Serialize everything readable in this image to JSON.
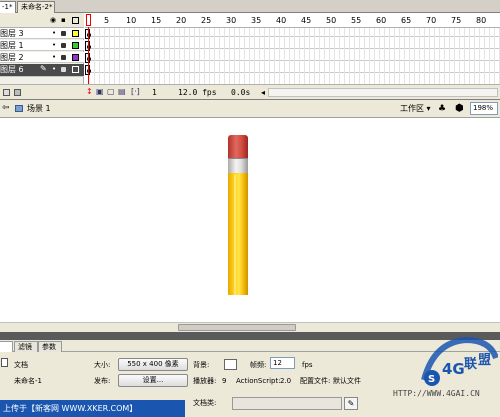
{
  "document_tabs": [
    "-1*",
    "未命名-2*"
  ],
  "timeline": {
    "header_icons": [
      "eye-icon",
      "lock-icon",
      "outline-icon"
    ],
    "ruler_numbers": [
      "1",
      "5",
      "10",
      "15",
      "20",
      "25",
      "30",
      "35",
      "40",
      "45",
      "50",
      "55",
      "60",
      "65",
      "70",
      "75",
      "80"
    ],
    "layers": [
      {
        "name": "图层 3",
        "outline_color": "#ffff33",
        "selected": false
      },
      {
        "name": "图层 1",
        "outline_color": "#33cc33",
        "selected": false
      },
      {
        "name": "图层 2",
        "outline_color": "#9933cc",
        "selected": false
      },
      {
        "name": "图层 6",
        "outline_color": "#4a4a4a",
        "selected": true
      }
    ],
    "current_frame": "1",
    "fps": "12.0 fps",
    "time": "0.0s"
  },
  "edit_bar": {
    "scene": "场景 1",
    "workspace": "工作区",
    "zoom": "198%"
  },
  "properties": {
    "tabs": [
      "",
      "滤镜",
      "参数"
    ],
    "doc_type": "文档",
    "doc_name": "未命名-1",
    "size_label": "大小:",
    "size_value": "550 x 400 像素",
    "publish_label": "发布:",
    "settings_button": "设置...",
    "bg_label": "背景:",
    "fps_label": "帧频:",
    "fps_value": "12",
    "fps_unit": "fps",
    "player_label": "播放器:",
    "player_value": "9",
    "actionscript_label": "ActionScript:",
    "actionscript_value": "2.0",
    "profile_label": "配置文件:",
    "profile_value": "默认文件",
    "doc_class_label": "文档类:"
  },
  "watermarks": {
    "upload": "上传于【新客网 WWW.XKER.COM】",
    "site": "HTTP://WWW.4GAI.CN",
    "seal_text": "S 4 G 联 盟"
  },
  "colors": {
    "playhead": "#e00000",
    "pencil_yellow": "#ffd21a",
    "eraser_red": "#d24a40",
    "watermark_blue": "#1a55b0"
  }
}
